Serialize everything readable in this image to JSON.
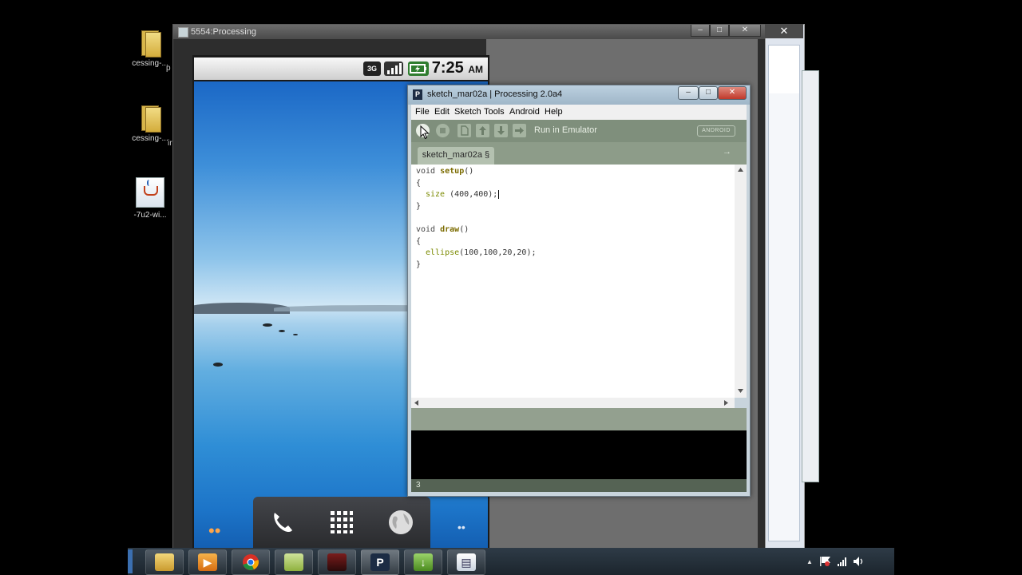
{
  "desktop": {
    "icons": [
      {
        "label": "cessing-...",
        "icon": "folder-icon"
      },
      {
        "label": "cessing-...",
        "icon": "folder-icon"
      },
      {
        "label": "-7u2-wi...",
        "icon": "java-installer-icon"
      }
    ],
    "partial_labels": [
      "p",
      "ir"
    ]
  },
  "emulator": {
    "title": "5554:Processing",
    "controls": {
      "minimize": "–",
      "maximize": "□",
      "close": "✕"
    },
    "status_bar": {
      "network": "3G",
      "signal_icon": "signal-bars-icon",
      "battery_icon": "battery-charging-icon",
      "time": "7:25",
      "ampm": "AM"
    },
    "dock": {
      "phone_icon": "phone-icon",
      "apps_icon": "app-grid-icon",
      "browser_icon": "globe-icon"
    },
    "side_dots_left": "••",
    "side_dots_right": "••"
  },
  "background_window": {
    "close": "✕"
  },
  "processing": {
    "title": "sketch_mar02a | Processing 2.0a4",
    "logo": "P",
    "controls": {
      "minimize": "–",
      "maximize": "□",
      "close": "✕"
    },
    "menu": [
      "File",
      "Edit",
      "Sketch",
      "Tools",
      "Android",
      "Help"
    ],
    "toolbar": {
      "buttons": [
        "run-icon",
        "stop-icon",
        "new-icon",
        "open-icon",
        "save-icon",
        "export-icon"
      ],
      "status_label": "Run in Emulator",
      "mode_button": "ANDROID"
    },
    "tab": {
      "label": "sketch_mar02a §",
      "arrow": "→"
    },
    "code": {
      "l1_kw": "void ",
      "l1_fn": "setup",
      "l1_rest": "()",
      "l2": "{",
      "l3_fn": "size",
      "l3_rest": " (400,400);",
      "l4": "}",
      "l6_kw": "void ",
      "l6_fn": "draw",
      "l6_rest": "()",
      "l7": "{",
      "l8_fn": "ellipse",
      "l8_rest": "(100,100,20,20);",
      "l9": "}"
    },
    "line_number": "3"
  },
  "taskbar": {
    "apps": [
      "windows-explorer-icon",
      "media-player-icon",
      "chrome-icon",
      "notepad-icon",
      "file-transfer-icon",
      "processing-icon",
      "download-icon",
      "document-icon"
    ]
  },
  "tray": {
    "up_arrow": "▲",
    "flag": "flag-icon",
    "network": "network-icon",
    "volume": "volume-icon"
  }
}
